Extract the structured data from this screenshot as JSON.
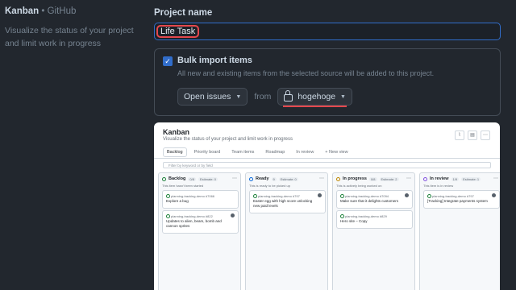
{
  "template": {
    "title": "Kanban",
    "source": "• GitHub",
    "description": "Visualize the status of your project and limit work in progress"
  },
  "form": {
    "project_name_label": "Project name",
    "project_name_value": "Life Task",
    "bulk_import": {
      "checked": true,
      "label": "Bulk import items",
      "sublabel": "All new and existing items from the selected source will be added to this project.",
      "source_select": "Open issues",
      "from_label": "from",
      "repo_select": "hogehoge"
    }
  },
  "preview": {
    "title": "Kanban",
    "description": "Visualize the status of your project and limit work in progress",
    "views": [
      "Backlog",
      "Priority board",
      "Team items",
      "Roadmap",
      "In review",
      "+ New view"
    ],
    "filter_placeholder": "Filter by keyword or by field",
    "columns": [
      {
        "name": "Backlog",
        "count": "0/8",
        "estimate": "Estimate: 0",
        "description": "This item hasn't been started",
        "color": "#1a7f37",
        "cards": [
          {
            "repo": "planning-tracking-demo #7066",
            "title": "Explore a bug",
            "avatar": false
          },
          {
            "repo": "planning-tracking-demo #822",
            "title": "Updates to alien, beam, bomb and cannon sprites",
            "avatar": true
          }
        ]
      },
      {
        "name": "Ready",
        "count": "9",
        "estimate": "Estimate: 0",
        "description": "This is ready to be picked up",
        "color": "#0969da",
        "cards": [
          {
            "repo": "planning-tracking-demo #797",
            "title": "Easter egg with high score unlocking new paid levels",
            "avatar": true
          }
        ]
      },
      {
        "name": "In progress",
        "count": "0/8",
        "estimate": "Estimate: 2",
        "description": "This is actively being worked on",
        "color": "#bf8700",
        "cards": [
          {
            "repo": "planning-tracking-demo #7094",
            "title": "Make sure that it delights customers",
            "avatar": true
          },
          {
            "repo": "planning-tracking-demo #829",
            "title": "Hero site – Copy",
            "avatar": false
          }
        ]
      },
      {
        "name": "In review",
        "count": "1/9",
        "estimate": "Estimate: 1",
        "description": "This item is in review",
        "color": "#8250df",
        "cards": [
          {
            "repo": "planning-tracking-demo #797",
            "title": "[Tracking] Integrate payments system",
            "avatar": true
          }
        ]
      }
    ]
  },
  "colors": {
    "accent": "#316dca",
    "highlight": "#e5484d"
  }
}
